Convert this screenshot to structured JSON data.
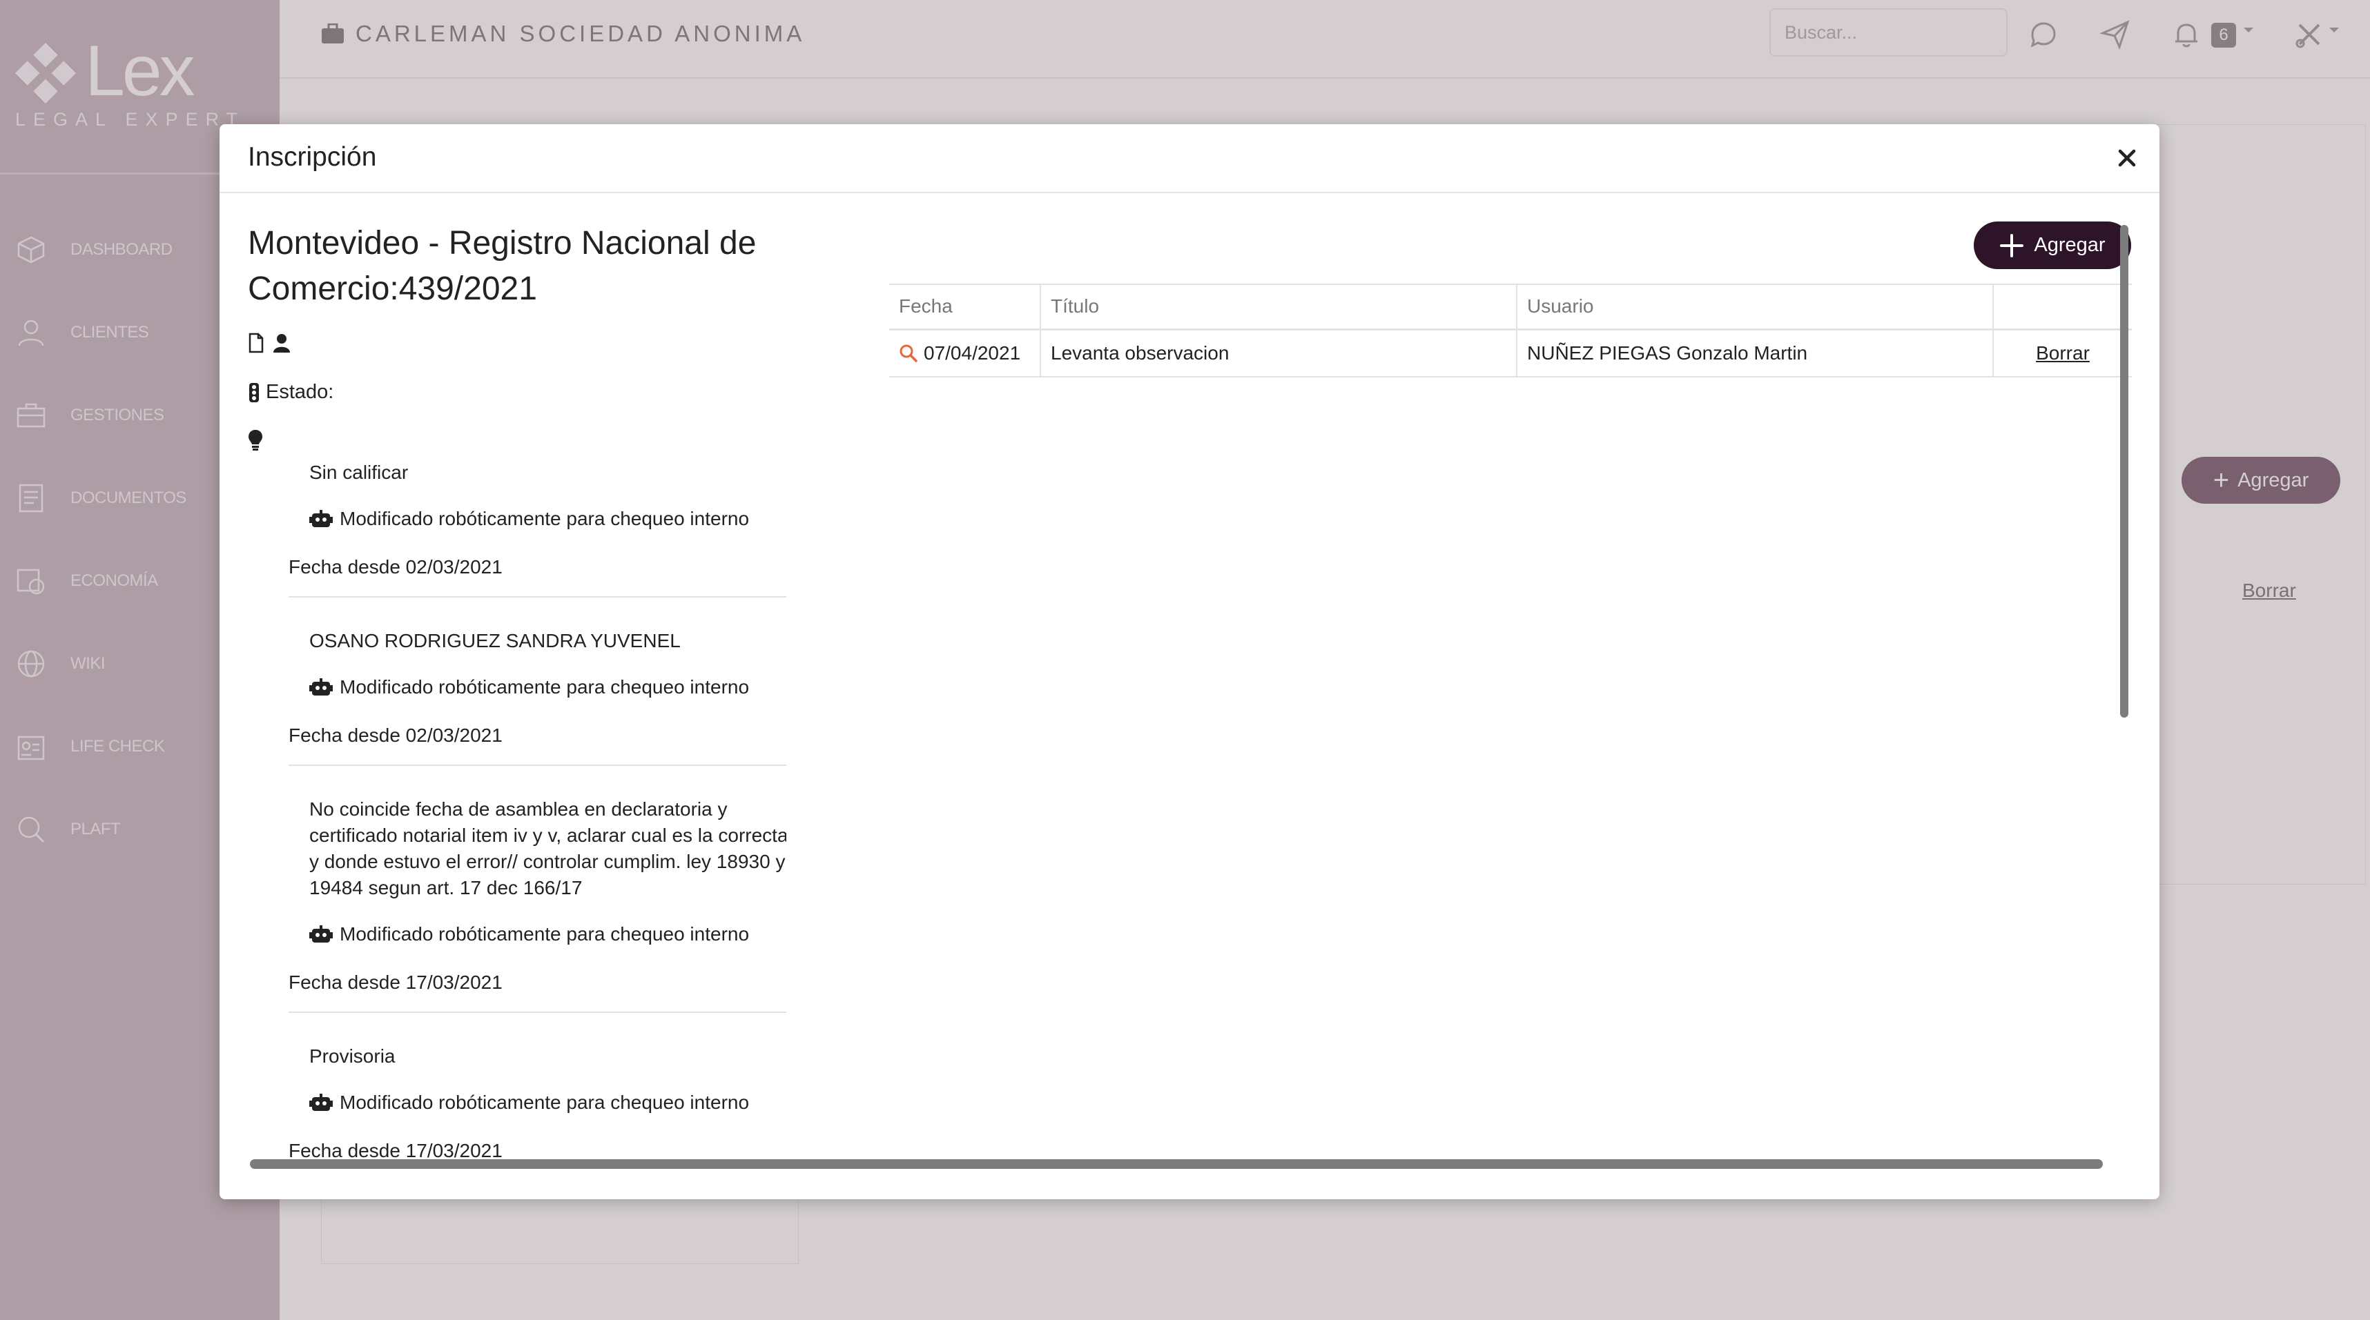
{
  "colors": {
    "sidebar": "#cfc1c7",
    "accent": "#2d1428",
    "search_icon": "#e8663a"
  },
  "brand": {
    "name": "Lex",
    "tagline": "LEGAL EXPERT"
  },
  "sidebar": {
    "items": [
      {
        "label": "DASHBOARD",
        "icon": "cube-icon"
      },
      {
        "label": "CLIENTES",
        "icon": "user-icon"
      },
      {
        "label": "GESTIONES",
        "icon": "briefcase-icon"
      },
      {
        "label": "DOCUMENTOS",
        "icon": "document-icon"
      },
      {
        "label": "ECONOMÍA",
        "icon": "economy-icon"
      },
      {
        "label": "WIKI",
        "icon": "globe-icon"
      },
      {
        "label": "LIFE CHECK",
        "icon": "id-card-icon"
      },
      {
        "label": "PLAFT",
        "icon": "search-icon"
      }
    ]
  },
  "topbar": {
    "company": "CARLEMAN SOCIEDAD ANONIMA",
    "search_placeholder": "Buscar...",
    "notifications": "6"
  },
  "background": {
    "agregar": "Agregar",
    "borrar": "Borrar"
  },
  "modal": {
    "title": "Inscripción",
    "registry_title": "Montevideo - Registro Nacional de Comercio:439/2021",
    "estado_label": "Estado:",
    "observations": [
      {
        "text": "Sin calificar",
        "note": "Modificado robóticamente para chequeo interno",
        "fecha": "Fecha desde 02/03/2021"
      },
      {
        "text": "OSANO RODRIGUEZ SANDRA YUVENEL",
        "note": "Modificado robóticamente para chequeo interno",
        "fecha": "Fecha desde 02/03/2021"
      },
      {
        "text": "No coincide fecha de asamblea en declaratoria y certificado notarial item iv y v, aclarar cual es la correcta y donde estuvo el error// controlar cumplim. ley 18930 y 19484 segun art. 17 dec 166/17",
        "note": "Modificado robóticamente para chequeo interno",
        "fecha": "Fecha desde 17/03/2021"
      },
      {
        "text": "Provisoria",
        "note": "Modificado robóticamente para chequeo interno",
        "fecha": "Fecha desde 17/03/2021"
      }
    ],
    "agregar_label": "Agregar",
    "table": {
      "headers": [
        "Fecha",
        "Título",
        "Usuario",
        ""
      ],
      "rows": [
        {
          "fecha": "07/04/2021",
          "titulo": "Levanta observacion",
          "usuario": "NUÑEZ PIEGAS Gonzalo Martin",
          "action": "Borrar"
        }
      ]
    }
  }
}
